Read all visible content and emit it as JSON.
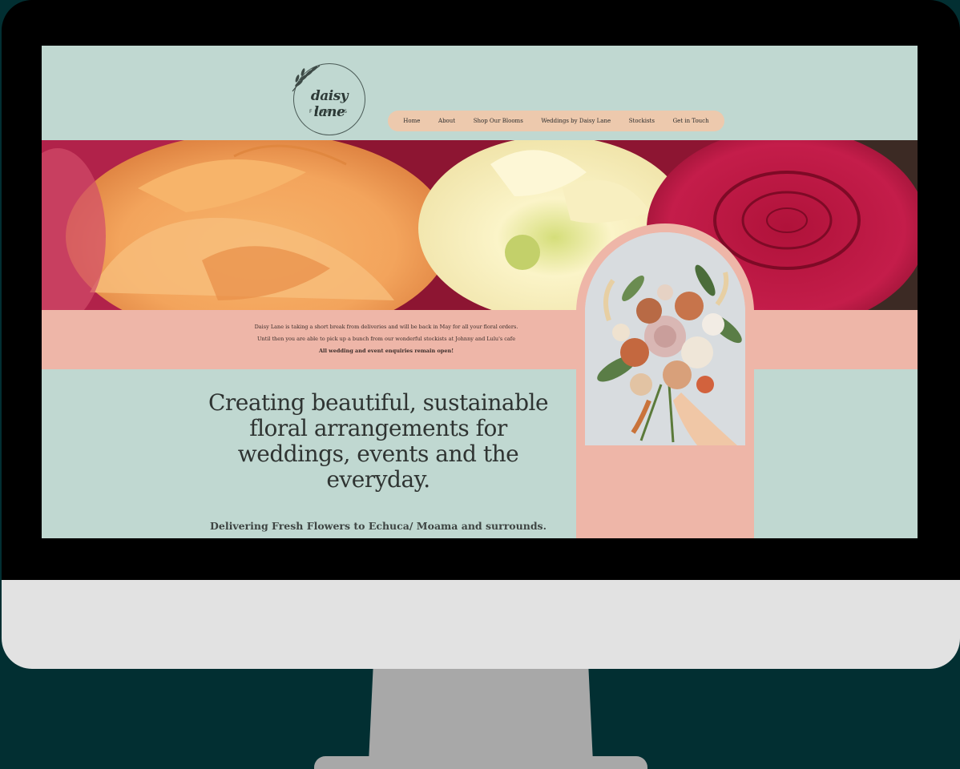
{
  "logo": {
    "main": "daisy lane",
    "sub": "FLOWERS"
  },
  "nav": {
    "items": [
      "Home",
      "About",
      "Shop Our Blooms",
      "Weddings by Daisy Lane",
      "Stockists",
      "Get in Touch"
    ]
  },
  "announcement": {
    "line1": "Daisy Lane is taking a short break from deliveries and will be back in May for all your floral orders.",
    "line2": "Until then you are able to pick up a bunch from our wonderful stockists at Johnny and Lulu's cafe",
    "line3": "All wedding and event enquiries remain open!"
  },
  "main": {
    "headline": "Creating beautiful, sustainable floral arrangements for weddings, events and the everyday.",
    "subline": "Delivering Fresh Flowers to Echuca/ Moama and surrounds."
  },
  "colors": {
    "background": "#022f32",
    "site_green": "#c0d8d1",
    "site_pink": "#eeb6a8",
    "nav_bg": "#edc9ad"
  }
}
